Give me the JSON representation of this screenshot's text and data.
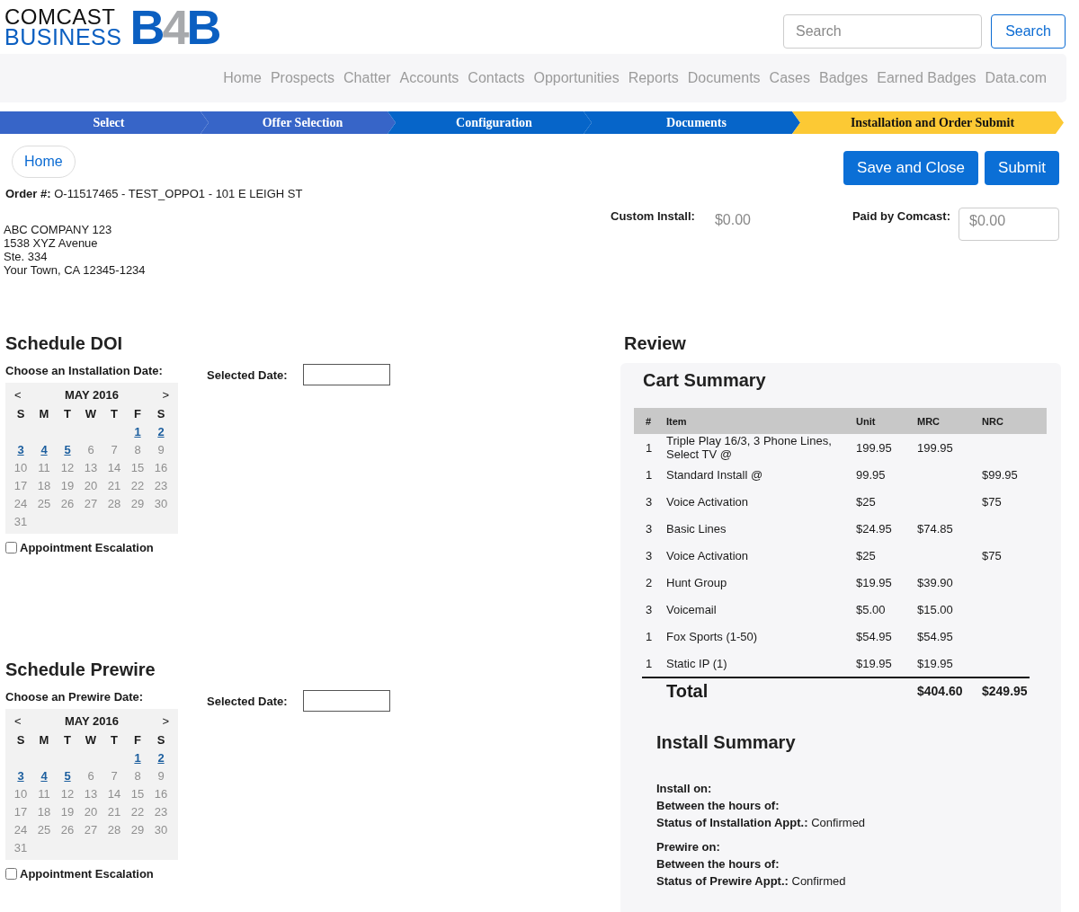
{
  "logo": {
    "line1": "COMCAST",
    "line2": "BUSINESS",
    "mark_parts": [
      {
        "text": "B",
        "color": "#0b5fc1"
      },
      {
        "text": "4",
        "color": "#a7a9ac"
      },
      {
        "text": "B",
        "color": "#0b5fc1"
      }
    ]
  },
  "search": {
    "placeholder": "Search",
    "button": "Search"
  },
  "nav": [
    "Home",
    "Prospects",
    "Chatter",
    "Accounts",
    "Contacts",
    "Opportunities",
    "Reports",
    "Documents",
    "Cases",
    "Badges",
    "Earned Badges",
    "Data.com"
  ],
  "steps": [
    {
      "label": "Select",
      "completed": true,
      "selected": false
    },
    {
      "label": "Offer Selection",
      "completed": true,
      "selected": false
    },
    {
      "label": "Configuration",
      "completed": false,
      "selected": false
    },
    {
      "label": "Documents",
      "completed": false,
      "selected": false
    },
    {
      "label": "Installation and Order Submit",
      "completed": false,
      "selected": true
    }
  ],
  "home_button": "Home",
  "order": {
    "label": "Order #:",
    "value": "O-11517465 - TEST_OPPO1 - 101 E LEIGH ST"
  },
  "address": [
    "ABC COMPANY 123",
    "1538 XYZ Avenue",
    "Ste. 334",
    "Your Town, CA 12345-1234"
  ],
  "actions": [
    "Save and Close",
    "Submit"
  ],
  "custom_install": {
    "label": "Custom Install:",
    "value": "$0.00"
  },
  "paid_by_comcast": {
    "label": "Paid by Comcast:",
    "placeholder": "$0.00"
  },
  "schedules": [
    {
      "title": "Schedule DOI",
      "choose_label": "Choose an Installation Date:",
      "selected_label": "Selected Date:",
      "calendar": {
        "prev": "<",
        "month": "MAY 2016",
        "next": ">",
        "weekdays": [
          "S",
          "M",
          "T",
          "W",
          "T",
          "F",
          "S"
        ],
        "weeks": [
          [
            {
              "day": "1",
              "available": true
            },
            {
              "day": "2",
              "available": true
            }
          ],
          [
            {
              "day": "3",
              "available": true
            },
            {
              "day": "4",
              "available": true
            },
            {
              "day": "5",
              "available": true
            },
            {
              "day": "6",
              "available": false
            },
            {
              "day": "7",
              "available": false
            },
            {
              "day": "8",
              "available": false
            },
            {
              "day": "9",
              "available": false
            }
          ],
          [
            {
              "day": "10",
              "available": false
            },
            {
              "day": "11",
              "available": false
            },
            {
              "day": "12",
              "available": false
            },
            {
              "day": "13",
              "available": false
            },
            {
              "day": "14",
              "available": false
            },
            {
              "day": "15",
              "available": false
            },
            {
              "day": "16",
              "available": false
            }
          ],
          [
            {
              "day": "17",
              "available": false
            },
            {
              "day": "18",
              "available": false
            },
            {
              "day": "19",
              "available": false
            },
            {
              "day": "20",
              "available": false
            },
            {
              "day": "21",
              "available": false
            },
            {
              "day": "22",
              "available": false
            },
            {
              "day": "23",
              "available": false
            }
          ],
          [
            {
              "day": "24",
              "available": false
            },
            {
              "day": "25",
              "available": false
            },
            {
              "day": "26",
              "available": false
            },
            {
              "day": "27",
              "available": false
            },
            {
              "day": "28",
              "available": false
            },
            {
              "day": "29",
              "available": false
            },
            {
              "day": "30",
              "available": false
            }
          ],
          [
            {
              "day": "31",
              "available": false
            }
          ]
        ]
      },
      "escalation": {
        "label": "Appointment Escalation",
        "checked": false
      }
    },
    {
      "title": "Schedule Prewire",
      "choose_label": "Choose an Prewire Date:",
      "selected_label": "Selected Date:",
      "calendar": {
        "prev": "<",
        "month": "MAY 2016",
        "next": ">",
        "weekdays": [
          "S",
          "M",
          "T",
          "W",
          "T",
          "F",
          "S"
        ],
        "weeks": [
          [
            {
              "day": "1",
              "available": true
            },
            {
              "day": "2",
              "available": true
            }
          ],
          [
            {
              "day": "3",
              "available": true
            },
            {
              "day": "4",
              "available": true
            },
            {
              "day": "5",
              "available": true
            },
            {
              "day": "6",
              "available": false
            },
            {
              "day": "7",
              "available": false
            },
            {
              "day": "8",
              "available": false
            },
            {
              "day": "9",
              "available": false
            }
          ],
          [
            {
              "day": "10",
              "available": false
            },
            {
              "day": "11",
              "available": false
            },
            {
              "day": "12",
              "available": false
            },
            {
              "day": "13",
              "available": false
            },
            {
              "day": "14",
              "available": false
            },
            {
              "day": "15",
              "available": false
            },
            {
              "day": "16",
              "available": false
            }
          ],
          [
            {
              "day": "17",
              "available": false
            },
            {
              "day": "18",
              "available": false
            },
            {
              "day": "19",
              "available": false
            },
            {
              "day": "20",
              "available": false
            },
            {
              "day": "21",
              "available": false
            },
            {
              "day": "22",
              "available": false
            },
            {
              "day": "23",
              "available": false
            }
          ],
          [
            {
              "day": "24",
              "available": false
            },
            {
              "day": "25",
              "available": false
            },
            {
              "day": "26",
              "available": false
            },
            {
              "day": "27",
              "available": false
            },
            {
              "day": "28",
              "available": false
            },
            {
              "day": "29",
              "available": false
            },
            {
              "day": "30",
              "available": false
            }
          ],
          [
            {
              "day": "31",
              "available": false
            }
          ]
        ]
      },
      "escalation": {
        "label": "Appointment Escalation",
        "checked": false
      }
    }
  ],
  "review": {
    "title": "Review",
    "cart": {
      "title": "Cart Summary",
      "columns": [
        "#",
        "Item",
        "Unit",
        "MRC",
        "NRC"
      ],
      "rows": [
        [
          "1",
          "Triple Play 16/3, 3 Phone Lines, Select TV @",
          "199.95",
          "199.95",
          null
        ],
        [
          "1",
          "Standard Install @",
          "99.95",
          null,
          "$99.95"
        ],
        [
          "3",
          "Voice Activation",
          "$25",
          null,
          "$75"
        ],
        [
          "3",
          "Basic Lines",
          "$24.95",
          "$74.85",
          null
        ],
        [
          "3",
          "Voice Activation",
          "$25",
          null,
          "$75"
        ],
        [
          "2",
          "Hunt Group",
          "$19.95",
          "$39.90",
          null
        ],
        [
          "3",
          "Voicemail",
          "$5.00",
          "$15.00",
          null
        ],
        [
          "1",
          "Fox Sports (1-50)",
          "$54.95",
          "$54.95",
          null
        ],
        [
          "1",
          "Static IP (1)",
          "$19.95",
          "$19.95",
          null
        ]
      ],
      "total": {
        "label": "Total",
        "mrc": "$404.60",
        "nrc": "$249.95"
      }
    },
    "install_summary": {
      "title": "Install Summary",
      "groups": [
        [
          {
            "label": "Install on:"
          },
          {
            "label": "Between the hours of:"
          },
          {
            "label": "Status of Installation Appt.:",
            "value": "Confirmed"
          }
        ],
        [
          {
            "label": "Prewire on:"
          },
          {
            "label": "Between the hours of:"
          },
          {
            "label": "Status of Prewire Appt.:",
            "value": "Confirmed"
          }
        ]
      ]
    }
  }
}
